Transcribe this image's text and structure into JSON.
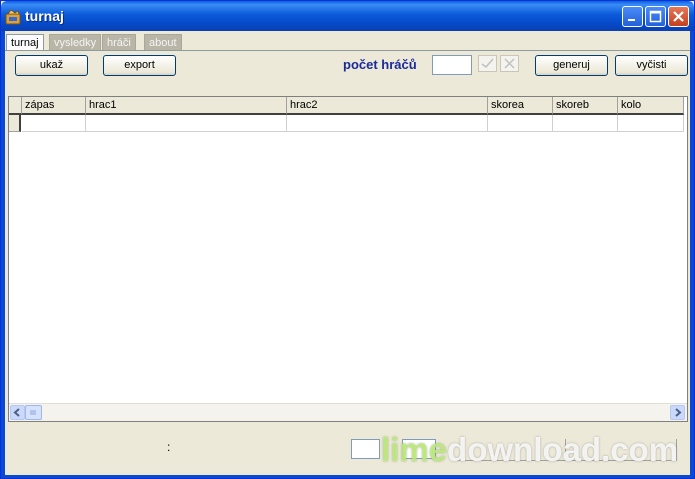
{
  "window": {
    "title": "turnaj",
    "icon": "app-icon",
    "controls": [
      "minimize-icon",
      "maximize-icon",
      "close-icon"
    ]
  },
  "tabs": [
    {
      "label": "turnaj",
      "active": true
    },
    {
      "label": "vysledky",
      "active": false
    },
    {
      "label": "hráči",
      "active": false
    },
    {
      "label": "about",
      "active": false
    }
  ],
  "toolbar": {
    "show_label": "ukaž",
    "export_label": "export",
    "player_count_label": "počet hráčů",
    "player_count_value": "",
    "generate_label": "generuj",
    "clear_label": "vyčisti"
  },
  "grid": {
    "columns": [
      "zápas",
      "hrac1",
      "hrac2",
      "skorea",
      "skoreb",
      "kolo"
    ],
    "rows": [
      [
        "",
        "",
        "",
        "",
        "",
        ""
      ]
    ]
  },
  "footer": {
    "colon": ":",
    "field1": "",
    "field2": ""
  },
  "watermark": {
    "part1": "lime",
    "part2": "download.com"
  },
  "colors": {
    "titlebar": "#0a5fe0",
    "face": "#ece9d8",
    "label_accent": "#1a2a9a"
  }
}
